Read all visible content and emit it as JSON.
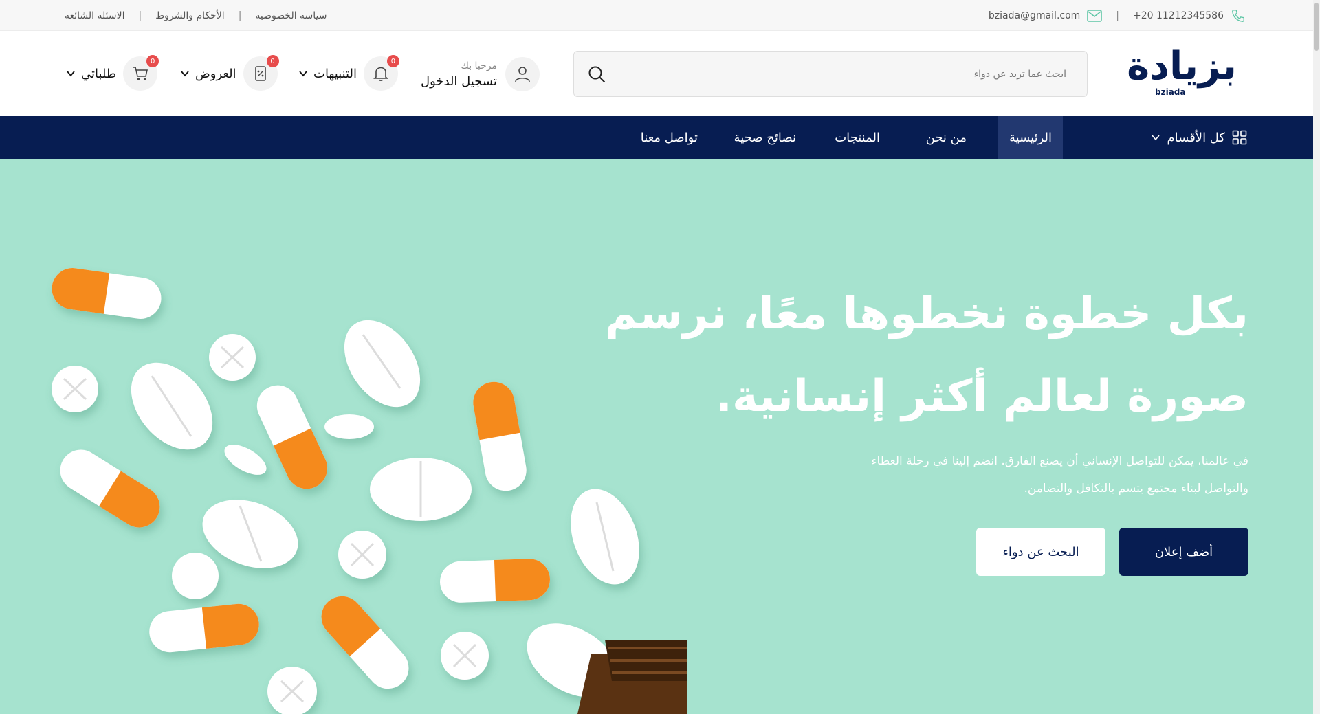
{
  "topbar": {
    "links": [
      "الاسئلة الشائعة",
      "الأحكام والشروط",
      "سياسة الخصوصية"
    ],
    "email": "bziada@gmail.com",
    "phone": "+20 11212345586",
    "separator": "|"
  },
  "header": {
    "logo_text": "بزيادة",
    "logo_sub": "bziada",
    "search_placeholder": "ابحث عما تريد عن دواء",
    "greeting": "مرحبا بك",
    "login": "تسجيل الدخول",
    "notifications": {
      "label": "التنبيهات",
      "count": "0"
    },
    "offers": {
      "label": "العروض",
      "count": "0"
    },
    "orders": {
      "label": "طلباتي",
      "count": "0"
    }
  },
  "nav": {
    "categories": "كل الأقسام",
    "items": [
      "الرئيسية",
      "من نحن",
      "المنتجات",
      "نصائح صحية",
      "تواصل معنا"
    ]
  },
  "hero": {
    "title_line1": "بكل خطوة نخطوها معًا، نرسم",
    "title_line2": "صورة لعالم أكثر إنسانية.",
    "desc_line1": "في عالمنا، يمكن للتواصل الإنساني أن يصنع الفارق. انضم إلينا في رحلة العطاء",
    "desc_line2": "والتواصل لبناء مجتمع يتسم بالتكافل والتضامن.",
    "primary_button": "أضف إعلان",
    "secondary_button": "البحث عن دواء"
  },
  "colors": {
    "navy": "#071d52",
    "hero_bg": "#a6e3cf",
    "badge": "#e74c4c",
    "pill_orange": "#f58a1f"
  }
}
